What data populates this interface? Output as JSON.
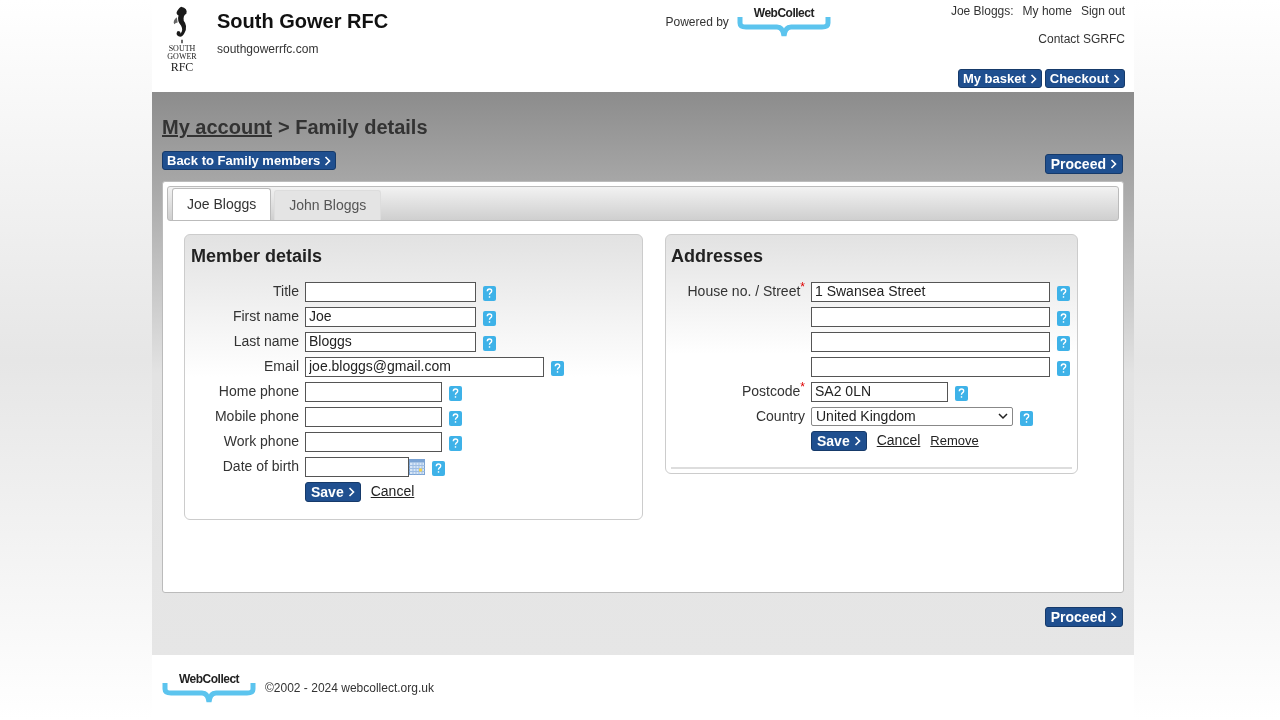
{
  "header": {
    "crest_text": [
      "SOUTH",
      "GOWER",
      "RFC"
    ],
    "club_name": "South Gower RFC",
    "club_url": "southgowerrfc.com",
    "powered_by": "Powered by",
    "brand_logo": "WebCollect",
    "user_name": "Joe Bloggs:",
    "user_links": [
      "My home",
      "Sign out"
    ],
    "contact_link": "Contact SGRFC",
    "buttons": [
      "My basket",
      "Checkout"
    ]
  },
  "breadcrumb": {
    "link": "My account",
    "current": "> Family details"
  },
  "back_button": "Back to Family members",
  "proceed_button_top": "Proceed",
  "tabs": [
    {
      "label": "Joe Bloggs",
      "selected": true
    },
    {
      "label": "John Bloggs",
      "selected": false
    }
  ],
  "member_details": {
    "title": "Member details",
    "fields": [
      {
        "label": "Title",
        "kind": "medium"
      },
      {
        "label": "First name",
        "value": "Joe",
        "kind": "medium"
      },
      {
        "label": "Last name",
        "value": "Bloggs",
        "kind": "medium"
      },
      {
        "label": "Email",
        "value": "joe.bloggs@gmail.com",
        "kind": "long"
      },
      {
        "label": "Home phone",
        "kind": "short"
      },
      {
        "label": "Mobile phone",
        "kind": "short"
      },
      {
        "label": "Work phone",
        "kind": "short"
      },
      {
        "label": "Date of birth",
        "kind": "date"
      }
    ],
    "save": "Save",
    "cancel": "Cancel"
  },
  "addresses": {
    "title": "Addresses",
    "fields": [
      {
        "label": "House no. / Street",
        "required_mark": "*",
        "value": "1 Swansea Street",
        "kind": "long"
      },
      {
        "kind": "long"
      },
      {
        "kind": "long"
      },
      {
        "kind": "long"
      },
      {
        "label": "Postcode",
        "required_mark": "*",
        "value": "SA2 0LN",
        "kind": "short"
      },
      {
        "label": "Country",
        "value": "United Kingdom",
        "kind": "select"
      }
    ],
    "save": "Save",
    "cancel": "Cancel",
    "remove": "Remove"
  },
  "proceed_button_bottom": "Proceed",
  "footer": {
    "brand_logo": "WebCollect",
    "copyright": "©2002 - 2024 webcollect.org.uk"
  }
}
